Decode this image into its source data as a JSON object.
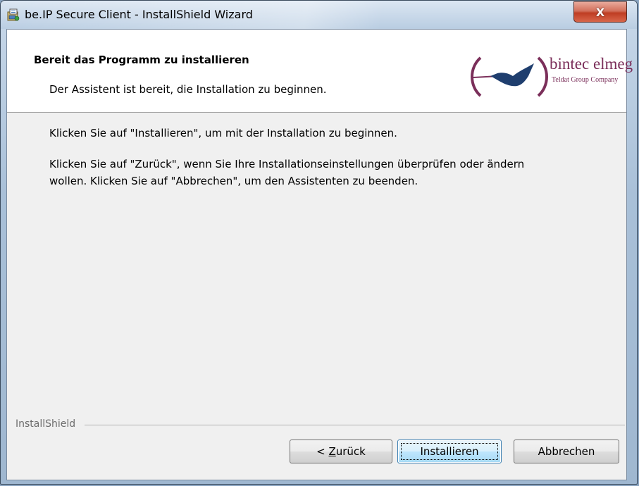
{
  "window": {
    "title": "be.IP Secure Client - InstallShield Wizard",
    "close_glyph": "X"
  },
  "banner": {
    "title": "Bereit das Programm zu installieren",
    "subtitle": "Der Assistent ist bereit, die Installation zu beginnen.",
    "logo": {
      "name": "bintec elmeg",
      "tagline": "Teldat Group Company",
      "color": "#7b2f5a"
    }
  },
  "content": {
    "line1": "Klicken Sie auf \"Installieren\", um mit der Installation zu beginnen.",
    "line2": "Klicken Sie auf \"Zurück\", wenn Sie Ihre Installationseinstellungen überprüfen oder ändern",
    "line3": "wollen. Klicken Sie auf \"Abbrechen\", um den Assistenten zu beenden."
  },
  "footer": {
    "branding": "InstallShield",
    "back_prefix": "< ",
    "back_mnemonic": "Z",
    "back_rest": "urück",
    "install_label": "Installieren",
    "cancel_label": "Abbrechen"
  },
  "icons": {
    "app": "installer-icon",
    "logo": "bird-logo-icon",
    "close": "close-icon"
  }
}
